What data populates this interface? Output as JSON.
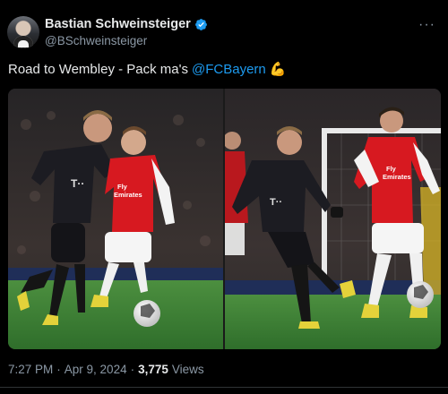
{
  "author": {
    "display_name": "Bastian Schweinsteiger",
    "handle": "@BSchweinsteiger",
    "verified_icon": "verified-badge-icon",
    "verified_color": "#1d9bf0"
  },
  "menu": {
    "more_label": "···"
  },
  "tweet": {
    "text": "Road to Wembley - Pack ma's",
    "mention": "@FCBayern",
    "emoji": "💪"
  },
  "media": {
    "photos": [
      {
        "shirt_text_bayern": "T··",
        "shirt_text_arsenal": "Fly Emirates"
      },
      {
        "shirt_text_bayern": "T··",
        "shirt_text_arsenal": "Fly Emirates"
      }
    ]
  },
  "meta": {
    "time": "7:27 PM",
    "date": "Apr 9, 2024",
    "views_count": "3,775",
    "views_label": "Views",
    "separator": "·"
  },
  "colors": {
    "background": "#000000",
    "text_primary": "#e7e9ea",
    "text_secondary": "#8b98a5",
    "link": "#1d9bf0",
    "arsenal_red": "#d71920",
    "bayern_kit": "#1c1c22",
    "pitch": "#3f8a3a"
  }
}
